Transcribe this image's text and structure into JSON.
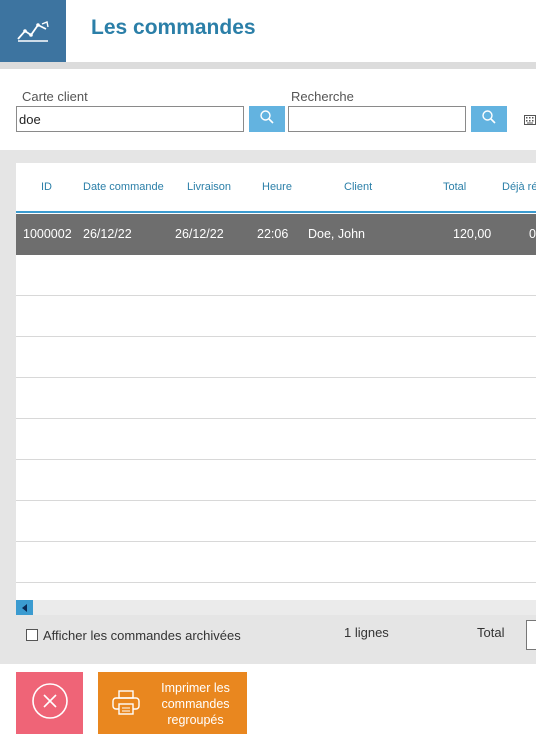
{
  "header": {
    "title": "Les commandes",
    "icon": "trend-chart-icon"
  },
  "search": {
    "card_label": "Carte client",
    "card_value": "doe",
    "search_label": "Recherche",
    "search_value": ""
  },
  "table": {
    "columns": [
      "ID",
      "Date commande",
      "Livraison",
      "Heure",
      "Client",
      "Total",
      "Déjà ré"
    ],
    "rows": [
      {
        "id": "1000002",
        "date_commande": "26/12/22",
        "livraison": "26/12/22",
        "heure": "22:06",
        "client": "Doe, John",
        "total": "120,00",
        "deja": "0"
      }
    ]
  },
  "footer": {
    "archived_label": "Afficher les commandes archivées",
    "archived_checked": false,
    "lines_count": "1 lignes",
    "total_label": "Total"
  },
  "actions": {
    "print_label": "Imprimer les commandes regroupés"
  },
  "colors": {
    "header_icon_bg": "#3d74a0",
    "title": "#2b7fa8",
    "search_button": "#63b3e0",
    "selected_row": "#6e6e6e",
    "cancel_button": "#ef6477",
    "print_button": "#e9871f"
  }
}
